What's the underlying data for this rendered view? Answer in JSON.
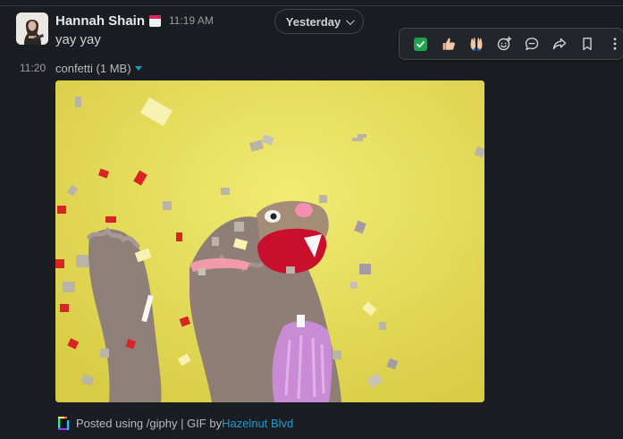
{
  "date_divider": {
    "label": "Yesterday"
  },
  "message": {
    "sender": "Hannah Shain",
    "timestamp": "11:19 AM",
    "text": "yay yay"
  },
  "toolbar": {
    "actions": [
      {
        "name": "check-mark-reaction",
        "icon": "white-check-mark-emoji"
      },
      {
        "name": "thumbs-up-reaction",
        "icon": "thumbs-up-emoji"
      },
      {
        "name": "raised-hands-reaction",
        "icon": "raised-hands-emoji"
      },
      {
        "name": "add-reaction",
        "icon": "emoji-plus-icon"
      },
      {
        "name": "reply-in-thread",
        "icon": "speech-bubble-icon"
      },
      {
        "name": "forward-message",
        "icon": "share-arrow-icon"
      },
      {
        "name": "save-for-later",
        "icon": "bookmark-icon"
      },
      {
        "name": "more-actions",
        "icon": "vertical-ellipsis-icon"
      }
    ]
  },
  "attachment": {
    "time": "11:20",
    "file_label": "confetti (1 MB)",
    "attribution_prefix": "Posted using /giphy | GIF by ",
    "attribution_link": "Hazelnut Blvd"
  },
  "colors": {
    "background": "#1a1d21",
    "link": "#1d9bd1",
    "gif_background": "#ece25f",
    "check_green": "#1ea34a"
  }
}
